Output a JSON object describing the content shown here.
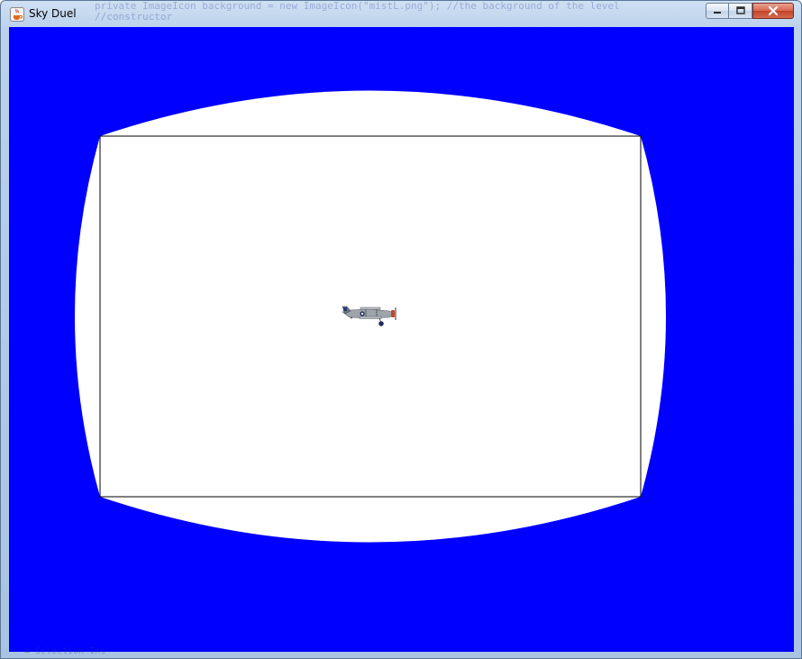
{
  "window": {
    "title": "Sky Duel",
    "background_text": "private ImageIcon background = new ImageIcon(\"mistL.png\"); //the background of the level",
    "background_text_2": "//constructor"
  },
  "controls": {
    "minimize": "minimize",
    "maximize": "maximize",
    "close": "close"
  },
  "game": {
    "sky_color": "#0000ff",
    "arena_color": "#ffffff",
    "border_color": "#000000",
    "player_sprite": "biplane-icon"
  },
  "status": {
    "ghost_text": "≡  Selection  Ins"
  }
}
